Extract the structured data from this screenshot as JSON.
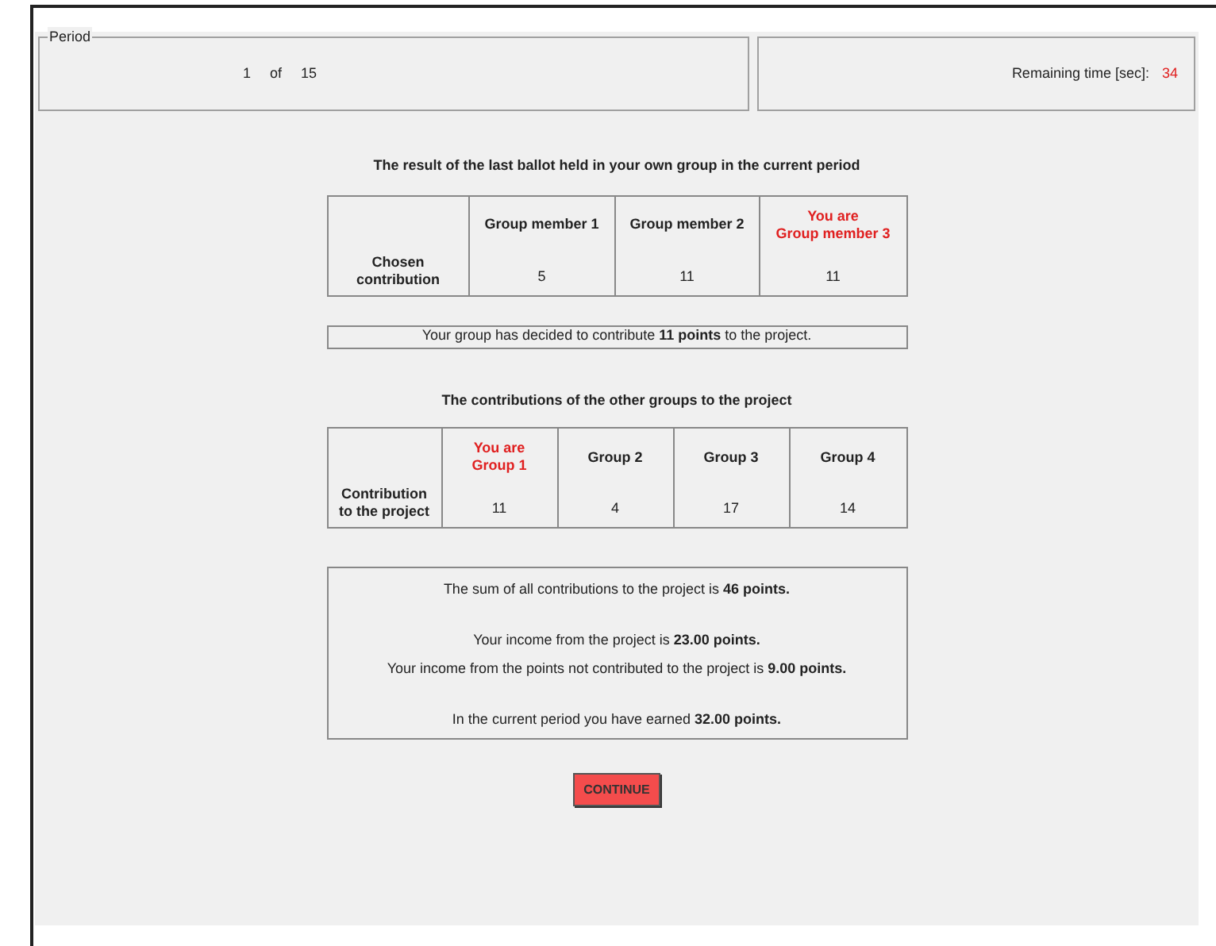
{
  "header": {
    "legend": "Period",
    "period": "1",
    "of": "of",
    "total": "15",
    "remaining_label": "Remaining time [sec]:",
    "remaining_value": "34"
  },
  "ballot": {
    "title": "The result of the last ballot held in your own group in the current period",
    "row_label": "Chosen contribution",
    "you_marker": "You are",
    "members": [
      {
        "label": "Group member 1",
        "value": "5",
        "selected": false
      },
      {
        "label": "Group member 2",
        "value": "11",
        "selected": false
      },
      {
        "label": "Group member 3",
        "value": "11",
        "selected": true
      }
    ]
  },
  "decision": "Your group has decided to contribute **11  points** to the project.",
  "groups": {
    "title": "The contributions of the other groups to the project",
    "row_label": "Contribution to the project",
    "you_marker": "You are",
    "items": [
      {
        "label": "Group 1",
        "value": "11",
        "selected": true
      },
      {
        "label": "Group 2",
        "value": "4",
        "selected": false
      },
      {
        "label": "Group 3",
        "value": "17",
        "selected": false
      },
      {
        "label": "Group 4",
        "value": "14",
        "selected": false
      }
    ]
  },
  "summary": [
    {
      "lines": [
        "The sum of all contributions to the project is **46 points.**"
      ]
    },
    {
      "lines": [
        "Your income from the project is **23.00 points.**",
        "Your income from the points not contributed to the project is **9.00 points.**"
      ]
    },
    {
      "lines": [
        "In the current period you have earned **32.00 points.**"
      ]
    }
  ],
  "button": "CONTINUE"
}
